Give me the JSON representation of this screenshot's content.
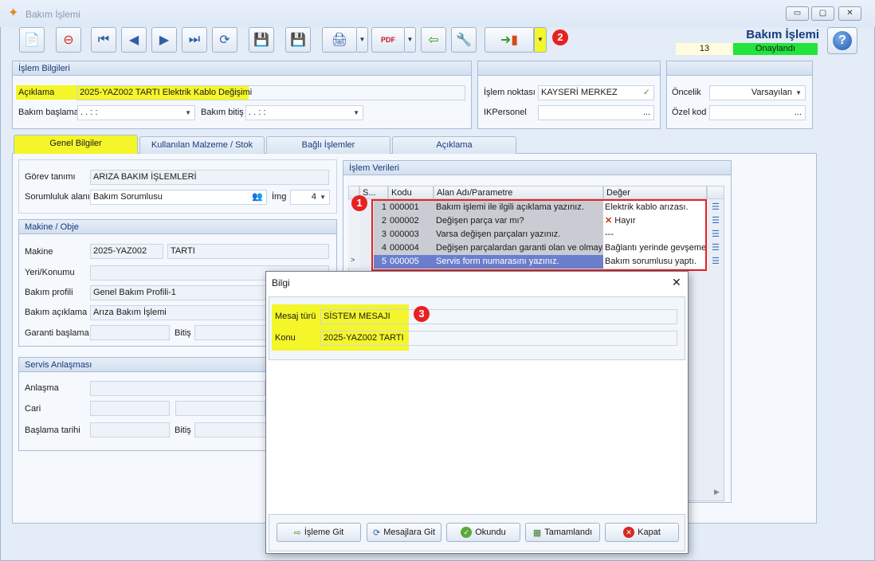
{
  "window": {
    "title": "Bakım İşlemi",
    "min": "▭",
    "max": "▢",
    "close": "✕"
  },
  "header": {
    "title": "Bakım İşlemi",
    "number": "13",
    "status": "Onaylandı"
  },
  "badges": {
    "b1": "1",
    "b2": "2",
    "b3": "3"
  },
  "islem_bilgileri": {
    "title": "İşlem Bilgileri",
    "aciklama_label": "Açıklama",
    "aciklama_value": "2025-YAZ002 TARTI Elektrik Kablo Değişimi",
    "bakim_baslama_label": "Bakım başlama",
    "bakim_baslama_value": ". .    : :",
    "bakim_bitis_label": "Bakım bitiş",
    "bakim_bitis_value": ". .    : :"
  },
  "islem_noktasi": {
    "label": "İşlem noktası",
    "value": "KAYSERİ MERKEZ",
    "ik_label": "IKPersonel",
    "ik_value": "...",
    "check": "✓"
  },
  "oncelik": {
    "label": "Öncelik",
    "value": "Varsayılan",
    "ozel_label": "Özel kod",
    "ozel_value": "..."
  },
  "tabs": [
    "Genel Bilgiler",
    "Kullanılan Malzeme / Stok",
    "Bağlı İşlemler",
    "Açıklama"
  ],
  "genel": {
    "gorev_label": "Görev tanımı",
    "gorev_value": "ARIZA BAKIM İŞLEMLERİ",
    "sorumluluk_label": "Sorumluluk alanı",
    "sorumluluk_value": "Bakım Sorumlusu",
    "img_label": "İmg",
    "img_value": "4"
  },
  "makine": {
    "title": "Makine / Obje",
    "makine_label": "Makine",
    "makine_code": "2025-YAZ002",
    "makine_name": "TARTI",
    "yeri_label": "Yeri/Konumu",
    "profil_label": "Bakım profili",
    "profil_value": "Genel Bakım Profili-1",
    "aciklama_label": "Bakım açıklama",
    "aciklama_value": "Arıza Bakım İşlemi",
    "garanti_label": "Garanti başlama",
    "bitis_label": "Bitiş"
  },
  "servis": {
    "title": "Servis Anlaşması",
    "anlasma_label": "Anlaşma",
    "cari_label": "Cari",
    "baslama_label": "Başlama tarihi",
    "bitis_label": "Bitiş"
  },
  "islem_verileri": {
    "title": "İşlem Verileri",
    "columns": [
      "S...",
      "Kodu",
      "Alan Adı/Parametre",
      "Değer"
    ],
    "rows": [
      {
        "s": "1",
        "kodu": "000001",
        "alan": "Bakım işlemi ile ilgili açıklama yazınız.",
        "deger": "Elektrik kablo arızası."
      },
      {
        "s": "2",
        "kodu": "000002",
        "alan": "Değişen parça var mı?",
        "deger": "Hayır"
      },
      {
        "s": "3",
        "kodu": "000003",
        "alan": "Varsa değişen parçaları yazınız.",
        "deger": "---"
      },
      {
        "s": "4",
        "kodu": "000004",
        "alan": "Değişen parçalardan garanti olan ve olmayan",
        "deger": "Bağlantı yerinde gevşeme"
      },
      {
        "s": "5",
        "kodu": "000005",
        "alan": "Servis form numarasını yazınız.",
        "deger": "Bakım sorumlusu yaptı."
      }
    ]
  },
  "dialog": {
    "title": "Bilgi",
    "close": "✕",
    "mesaj_turu_label": "Mesaj türü",
    "mesaj_turu_value": "SİSTEM MESAJI",
    "konu_label": "Konu",
    "konu_value": "2025-YAZ002 TARTI",
    "buttons": [
      "İşleme Git",
      "Mesajlara Git",
      "Okundu",
      "Tamamlandı",
      "Kapat"
    ]
  }
}
